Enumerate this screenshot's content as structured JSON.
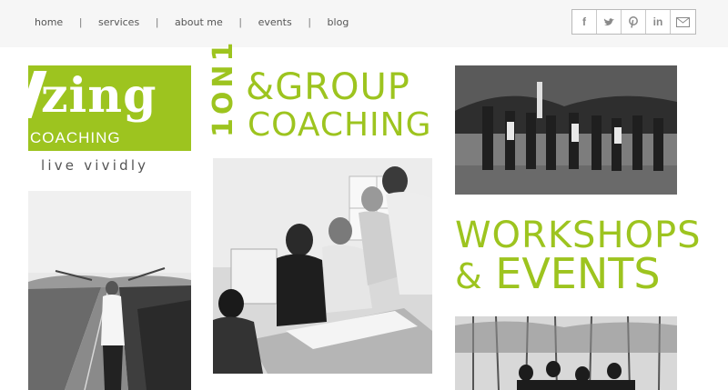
{
  "nav": {
    "items": [
      {
        "label": "home"
      },
      {
        "label": "services"
      },
      {
        "label": "about me"
      },
      {
        "label": "events"
      },
      {
        "label": "blog"
      }
    ],
    "separator": "|"
  },
  "social": {
    "facebook": "f",
    "twitter": "t",
    "pinterest": "p",
    "linkedin": "in",
    "email": "✉"
  },
  "logo": {
    "word": "zing",
    "sub": "COACHING",
    "tagline": "live vividly"
  },
  "coaching": {
    "one_on_one": "1ON1",
    "ampersand": "&",
    "group": "GROUP",
    "coaching": "COACHING"
  },
  "workshops": {
    "line1": "WORKSHOPS",
    "ampersand": "&",
    "line2": "EVENTS"
  },
  "colors": {
    "accent": "#9dc41f",
    "nav_text": "#555555",
    "topbar": "#f6f6f6"
  }
}
